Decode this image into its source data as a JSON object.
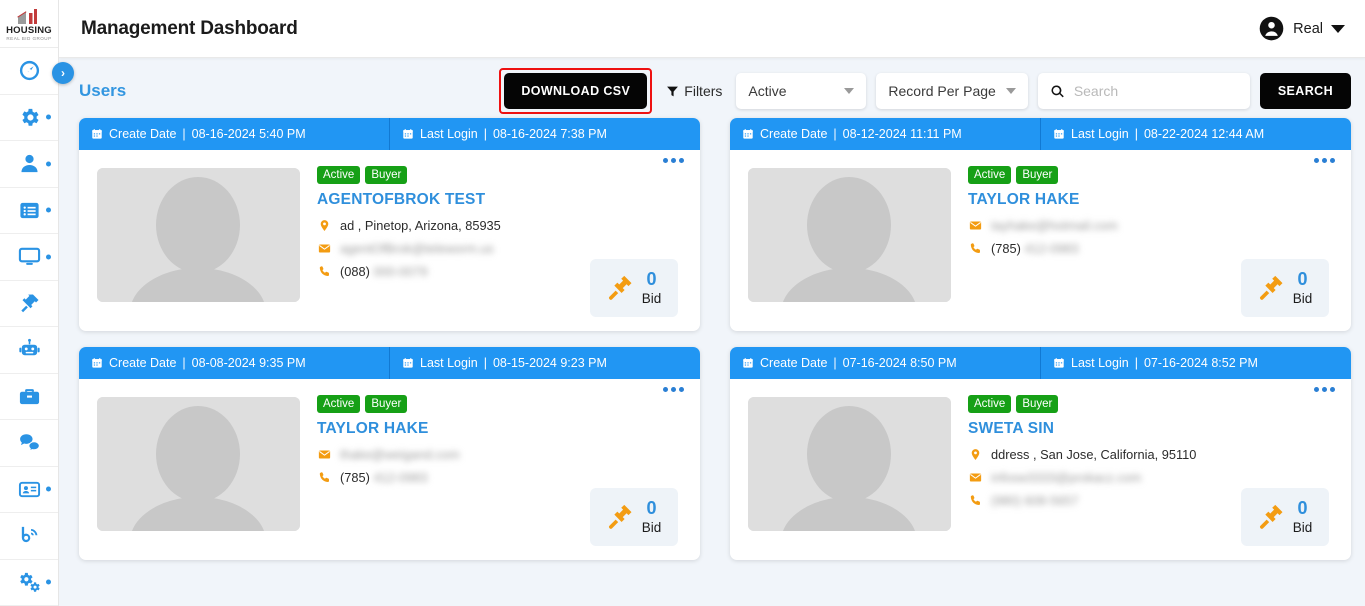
{
  "brand": {
    "logo_word": "HOUSING",
    "logo_sub": "REAL BID GROUP",
    "accent_blue": "#2a93e4",
    "card_header_blue": "#2196f3",
    "badge_green": "#16a016",
    "icon_orange": "#f39c12",
    "highlight_red": "#ee1111"
  },
  "header": {
    "title": "Management Dashboard",
    "user_name": "Real"
  },
  "sidebar": {
    "collapse_label": "›",
    "items": [
      {
        "name": "dashboard",
        "icon": "speedometer-icon",
        "dot": false
      },
      {
        "name": "settings",
        "icon": "gear-icon",
        "dot": true
      },
      {
        "name": "users",
        "icon": "user-icon",
        "dot": true
      },
      {
        "name": "listings",
        "icon": "list-icon",
        "dot": true
      },
      {
        "name": "monitor",
        "icon": "monitor-icon",
        "dot": true
      },
      {
        "name": "auctions",
        "icon": "hammer-icon",
        "dot": false
      },
      {
        "name": "bots",
        "icon": "robot-icon",
        "dot": false
      },
      {
        "name": "jobs",
        "icon": "briefcase-icon",
        "dot": false
      },
      {
        "name": "messages",
        "icon": "chat-icon",
        "dot": false
      },
      {
        "name": "contacts",
        "icon": "id-card-icon",
        "dot": true
      },
      {
        "name": "blog",
        "icon": "blog-icon",
        "dot": false
      },
      {
        "name": "configuration",
        "icon": "gears-icon",
        "dot": true
      }
    ]
  },
  "toolbar": {
    "section_title": "Users",
    "download_csv_label": "DOWNLOAD CSV",
    "filters_label": "Filters",
    "status_select_value": "Active",
    "record_per_page_value": "Record Per Page",
    "search_placeholder": "Search",
    "search_value": "",
    "search_button_label": "SEARCH"
  },
  "labels": {
    "create_date": "Create Date",
    "last_login": "Last Login",
    "bid": "Bid",
    "separator": "|"
  },
  "cards": [
    {
      "create_date": "08-16-2024 5:40 PM",
      "last_login": "08-16-2024 7:38 PM",
      "badges": [
        "Active",
        "Buyer"
      ],
      "name": "AGENTOFBROK TEST",
      "address": "ad , Pinetop, Arizona, 85935",
      "has_address": true,
      "email": "agentOfBrok@teleworm.us",
      "email_blurred": true,
      "phone_visible": "(088)",
      "phone_blurred": "000-0079",
      "bid_count": "0"
    },
    {
      "create_date": "08-12-2024 11:11 PM",
      "last_login": "08-22-2024 12:44 AM",
      "badges": [
        "Active",
        "Buyer"
      ],
      "name": "TAYLOR HAKE",
      "address": "",
      "has_address": false,
      "email": "tayhake@hotmail.com",
      "email_blurred": true,
      "phone_visible": "(785)",
      "phone_blurred": "412-0983",
      "bid_count": "0"
    },
    {
      "create_date": "08-08-2024 9:35 PM",
      "last_login": "08-15-2024 9:23 PM",
      "badges": [
        "Active",
        "Buyer"
      ],
      "name": "TAYLOR HAKE",
      "address": "",
      "has_address": false,
      "email": "thake@weigand.com",
      "email_blurred": true,
      "phone_visible": "(785)",
      "phone_blurred": "412-0983",
      "bid_count": "0"
    },
    {
      "create_date": "07-16-2024 8:50 PM",
      "last_login": "07-16-2024 8:52 PM",
      "badges": [
        "Active",
        "Buyer"
      ],
      "name": "SWETA SIN",
      "address": "ddress , San Jose, California, 95110",
      "has_address": true,
      "email": "infosw3333@prokacz.com",
      "email_blurred": true,
      "phone_visible": "",
      "phone_blurred": "(980) 608-5657",
      "bid_count": "0"
    }
  ]
}
